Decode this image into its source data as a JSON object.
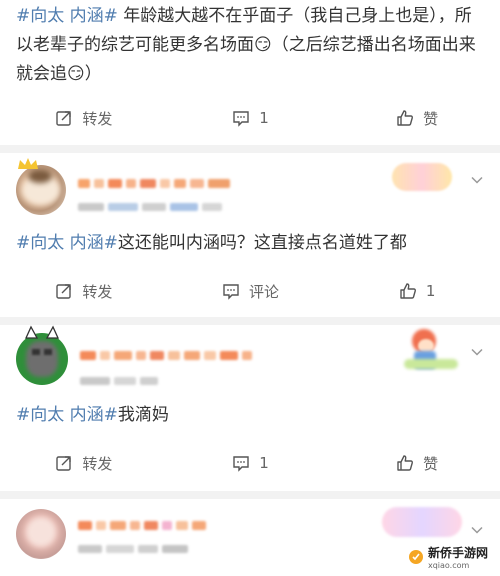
{
  "posts": [
    {
      "text_parts": [
        {
          "text": "#向太 内涵#",
          "hashtag": true
        },
        {
          "text": " 年龄越大越不在乎面子（我自己身上也是），所以老辈子的综艺可能更多名场面",
          "hashtag": false
        },
        {
          "text": "😏",
          "hashtag": false
        },
        {
          "text": "（之后综艺播出名场面出来就会追",
          "hashtag": false
        },
        {
          "text": "😏",
          "hashtag": false
        },
        {
          "text": "）",
          "hashtag": false
        }
      ],
      "actions": {
        "repost": "转发",
        "comment": "1",
        "like": "赞"
      }
    },
    {
      "text_parts": [
        {
          "text": "#向太 内涵#",
          "hashtag": true
        },
        {
          "text": "这还能叫内涵吗？这直接点名道姓了都",
          "hashtag": false
        }
      ],
      "actions": {
        "repost": "转发",
        "comment": "评论",
        "like": "1"
      }
    },
    {
      "text_parts": [
        {
          "text": "#向太 内涵#",
          "hashtag": true
        },
        {
          "text": "我滴妈",
          "hashtag": false
        }
      ],
      "actions": {
        "repost": "转发",
        "comment": "1",
        "like": "赞"
      }
    }
  ],
  "watermark": {
    "title": "新侨手游网",
    "sub": "xqiao.com"
  },
  "colors": {
    "hashtag": "#507daf",
    "text": "#333333",
    "action": "#666666",
    "separator": "#f2f2f2"
  },
  "icons": [
    "repost-icon",
    "comment-icon",
    "like-icon",
    "chevron-down-icon"
  ]
}
